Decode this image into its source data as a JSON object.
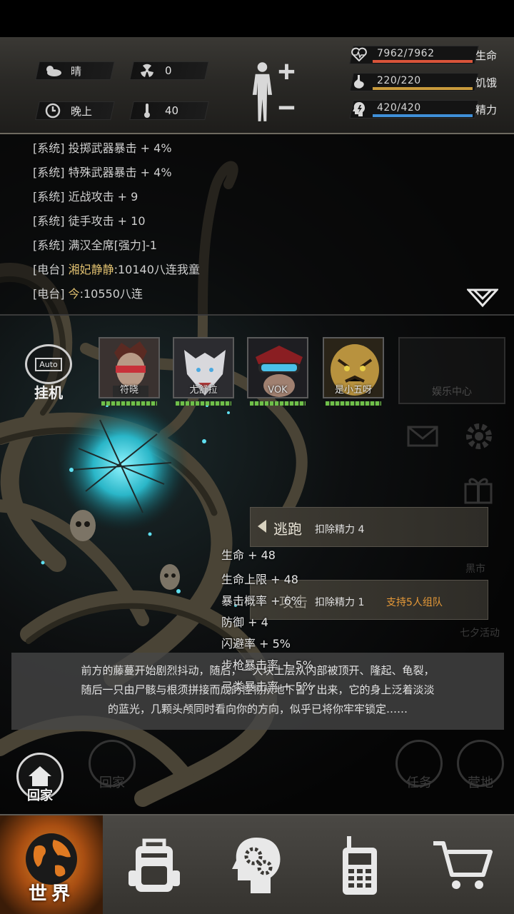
{
  "header": {
    "weather": {
      "icon": "cloud-sun-icon",
      "value": "晴"
    },
    "radiation": {
      "icon": "radiation-icon",
      "value": "0"
    },
    "time": {
      "icon": "clock-icon",
      "value": "晚上"
    },
    "temperature": {
      "icon": "thermometer-icon",
      "value": "40"
    },
    "stats": [
      {
        "icon": "heart-pulse-icon",
        "value": "7962/7962",
        "label": "生命",
        "color": "#d9543a",
        "ratio": 1.0
      },
      {
        "icon": "stomach-icon",
        "value": "220/220",
        "label": "饥饿",
        "color": "#c89a3c",
        "ratio": 1.0
      },
      {
        "icon": "energy-head-icon",
        "value": "420/420",
        "label": "精力",
        "color": "#3f8fd8",
        "ratio": 1.0
      }
    ]
  },
  "log": [
    {
      "tag": "[系统]",
      "text": "投掷武器暴击 + 4%",
      "who": ""
    },
    {
      "tag": "[系统]",
      "text": "特殊武器暴击 + 4%",
      "who": ""
    },
    {
      "tag": "[系统]",
      "text": "近战攻击 + 9",
      "who": ""
    },
    {
      "tag": "[系统]",
      "text": "徒手攻击 + 10",
      "who": ""
    },
    {
      "tag": "[系统]",
      "text": "满汉全席[强力]-1",
      "who": ""
    },
    {
      "tag": "[电台]",
      "text": ":10140八连我童",
      "who": "湘妃静静"
    },
    {
      "tag": "[电台]",
      "text": ":10550八连",
      "who": "今"
    }
  ],
  "auto": {
    "screen": "Auto",
    "label": "挂机"
  },
  "party": [
    {
      "name": "符晓"
    },
    {
      "name": "尤舒拉"
    },
    {
      "name": "VOK"
    },
    {
      "name": "是小五呀"
    }
  ],
  "entertainment": {
    "label": "娱乐中心"
  },
  "faded": {
    "black_market": "黑市",
    "activity": "七夕活动"
  },
  "actions": [
    {
      "title": "逃跑",
      "sub": "扣除精力 4",
      "extra": ""
    },
    {
      "title": "攻击",
      "sub": "扣除精力 1",
      "extra": "支持5人组队"
    }
  ],
  "buffs": [
    "生命 + 48",
    "生命上限 + 48",
    "暴击概率 + 6%",
    "防御 + 4",
    "闪避率 + 5%",
    "步枪暴击率 + 5%",
    "弓类暴击率 + 5%"
  ],
  "narration": [
    "前方的藤蔓开始剧烈抖动，随后，一大块土层从内部被顶开、隆起、龟裂，",
    "随后一只由尸骸与根须拼接而成的怪物从地下冒了出来，它的身上泛着淡淡",
    "的蓝光，几颗头颅同时看向你的方向，似乎已将你牢牢锁定……"
  ],
  "home": {
    "label": "回家"
  },
  "ghost": {
    "home": "回家",
    "task": "任务",
    "camp": "营地"
  },
  "nav": [
    {
      "label": "世界",
      "icon": "globe-icon"
    },
    {
      "label": "",
      "icon": "backpack-icon"
    },
    {
      "label": "",
      "icon": "brain-head-icon"
    },
    {
      "label": "",
      "icon": "walkie-talkie-icon"
    },
    {
      "label": "",
      "icon": "shopping-cart-icon"
    }
  ]
}
